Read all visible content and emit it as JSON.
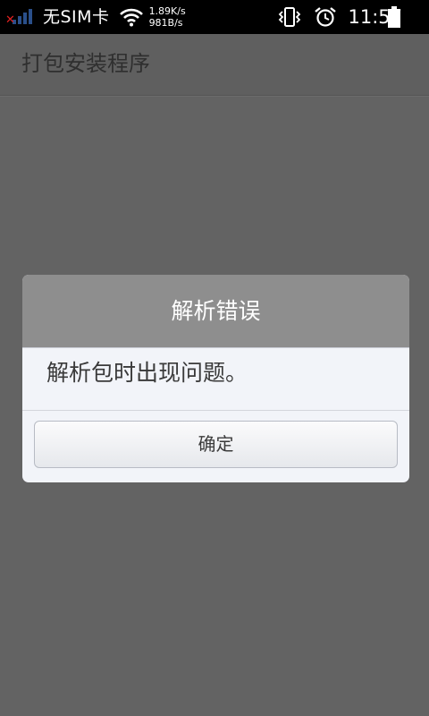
{
  "status_bar": {
    "carrier": "无SIM卡",
    "upload_speed": "1.89K/s",
    "download_speed": "981B/s",
    "time": "11:57",
    "icons": [
      "no-signal-icon",
      "wifi-icon",
      "vibrate-icon",
      "alarm-clock-icon",
      "battery-icon"
    ]
  },
  "app_bar": {
    "title": "打包安装程序"
  },
  "dialog": {
    "title": "解析错误",
    "message": "解析包时出现问题。",
    "confirm_label": "确定"
  },
  "colors": {
    "status_bar_bg": "#000000",
    "screen_dim_bg": "#636363",
    "dialog_header_bg": "#8e8e8e",
    "dialog_body_bg": "#f2f4f9",
    "signal_error": "#e02020"
  }
}
